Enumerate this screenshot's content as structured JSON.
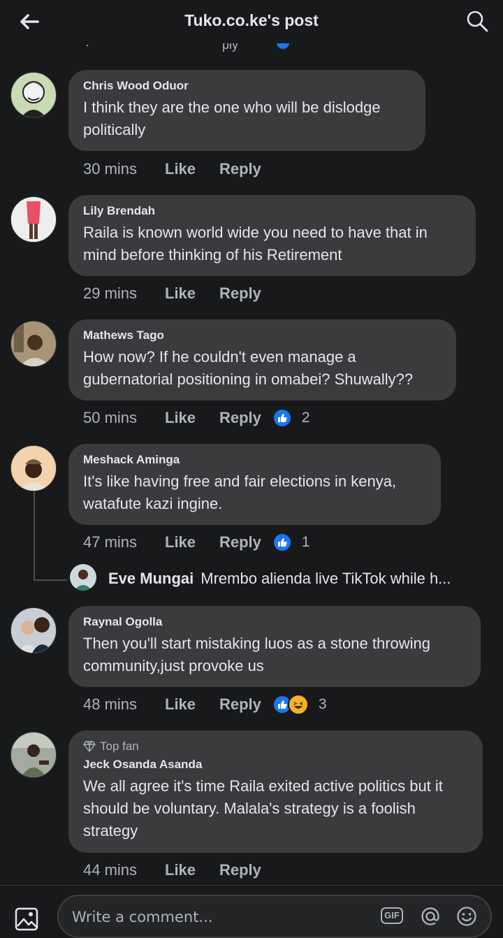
{
  "header": {
    "title": "Tuko.co.ke's post"
  },
  "partial_row": {
    "time": "·",
    "reply_fragment": "ply"
  },
  "comments": [
    {
      "author": "Chris Wood Oduor",
      "text": "I think they are the one who will be dislodge politically",
      "time": "30 mins",
      "like": "Like",
      "reply": "Reply"
    },
    {
      "author": "Lily Brendah",
      "text": "Raila is known world wide you need to have that in mind before thinking of his Retirement",
      "time": "29 mins",
      "like": "Like",
      "reply": "Reply"
    },
    {
      "author": "Mathews Tago",
      "text": "How now? If he couldn't even manage a gubernatorial positioning in omabei? Shuwally??",
      "time": "50 mins",
      "like": "Like",
      "reply": "Reply",
      "reactions": {
        "types": [
          "like"
        ],
        "count": "2"
      }
    },
    {
      "author": "Meshack Aminga",
      "text": "It's like having free and fair elections in kenya, watafute kazi ingine.",
      "time": "47 mins",
      "like": "Like",
      "reply": "Reply",
      "reactions": {
        "types": [
          "like"
        ],
        "count": "1"
      }
    },
    {
      "author": "Raynal Ogolla",
      "text": "Then you'll start mistaking luos as a stone throwing community,just provoke us",
      "time": "48 mins",
      "like": "Like",
      "reply": "Reply",
      "reactions": {
        "types": [
          "like",
          "haha"
        ],
        "count": "3"
      }
    },
    {
      "author": "Jeck Osanda Asanda",
      "badge": "Top fan",
      "text": "We all agree it's time Raila exited active politics but it should be voluntary. Malala's strategy is a foolish strategy",
      "time": "44 mins",
      "like": "Like",
      "reply": "Reply"
    }
  ],
  "reply_preview": {
    "author": "Eve Mungai",
    "snippet": "Mrembo alienda live TikTok while h..."
  },
  "composer": {
    "placeholder": "Write a comment...",
    "gif_label": "GIF"
  },
  "colors": {
    "background": "#18191a",
    "bubble": "#3a3b3c",
    "accent": "#1877f2",
    "muted": "#b0b3b8"
  },
  "icons": [
    "back-arrow-icon",
    "search-icon",
    "like-reaction-icon",
    "haha-reaction-icon",
    "diamond-icon",
    "photo-icon",
    "gif-icon",
    "at-icon",
    "emoji-icon"
  ]
}
